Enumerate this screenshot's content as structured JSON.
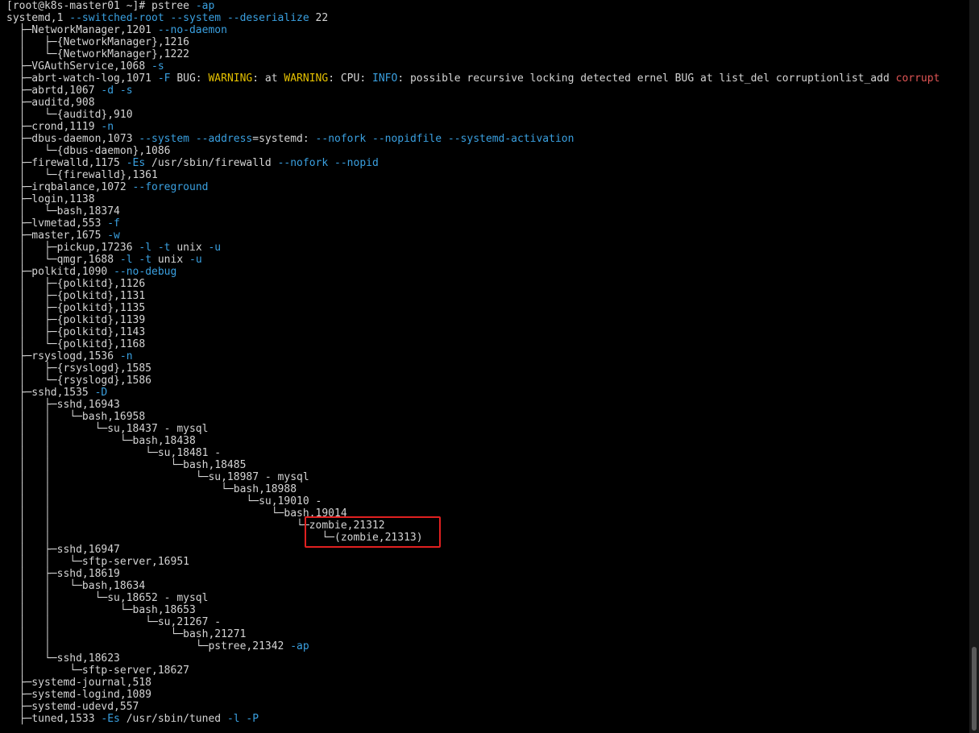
{
  "colors": {
    "background": "#000000",
    "text": "#d4d4d4",
    "arg": "#3aa0e0",
    "warn": "#e5c100",
    "info": "#3aa0e0",
    "err": "#e05555",
    "highlight_border": "#e02020"
  },
  "terminal": {
    "lines": [
      [
        {
          "t": "[root@k8s-master01 ~]# pstree "
        },
        {
          "t": "-ap",
          "c": "arg"
        }
      ],
      [
        {
          "t": "systemd,1 "
        },
        {
          "t": "--switched-root --system --deserialize",
          "c": "arg"
        },
        {
          "t": " 22"
        }
      ],
      [
        {
          "t": "  ├─NetworkManager,1201 "
        },
        {
          "t": "--no-daemon",
          "c": "arg"
        }
      ],
      [
        {
          "t": "  │   ├─{NetworkManager},1216"
        }
      ],
      [
        {
          "t": "  │   └─{NetworkManager},1222"
        }
      ],
      [
        {
          "t": "  ├─VGAuthService,1068 "
        },
        {
          "t": "-s",
          "c": "arg"
        }
      ],
      [
        {
          "t": "  ├─abrt-watch-log,1071 "
        },
        {
          "t": "-F",
          "c": "arg"
        },
        {
          "t": " BUG: "
        },
        {
          "t": "WARNING",
          "c": "warn"
        },
        {
          "t": ": at "
        },
        {
          "t": "WARNING",
          "c": "warn"
        },
        {
          "t": ": CPU: "
        },
        {
          "t": "INFO",
          "c": "info"
        },
        {
          "t": ": possible recursive locking detected ernel BUG at list_del corruptionlist_add "
        },
        {
          "t": "corrupt",
          "c": "err"
        }
      ],
      [
        {
          "t": "  ├─abrtd,1067 "
        },
        {
          "t": "-d -s",
          "c": "arg"
        }
      ],
      [
        {
          "t": "  ├─auditd,908"
        }
      ],
      [
        {
          "t": "  │   └─{auditd},910"
        }
      ],
      [
        {
          "t": "  ├─crond,1119 "
        },
        {
          "t": "-n",
          "c": "arg"
        }
      ],
      [
        {
          "t": "  ├─dbus-daemon,1073 "
        },
        {
          "t": "--system --address",
          "c": "arg"
        },
        {
          "t": "=systemd: "
        },
        {
          "t": "--nofork --nopidfile --systemd-activation",
          "c": "arg"
        }
      ],
      [
        {
          "t": "  │   └─{dbus-daemon},1086"
        }
      ],
      [
        {
          "t": "  ├─firewalld,1175 "
        },
        {
          "t": "-Es",
          "c": "arg"
        },
        {
          "t": " /usr/sbin/firewalld "
        },
        {
          "t": "--nofork --nopid",
          "c": "arg"
        }
      ],
      [
        {
          "t": "  │   └─{firewalld},1361"
        }
      ],
      [
        {
          "t": "  ├─irqbalance,1072 "
        },
        {
          "t": "--foreground",
          "c": "arg"
        }
      ],
      [
        {
          "t": "  ├─login,1138"
        }
      ],
      [
        {
          "t": "  │   └─bash,18374"
        }
      ],
      [
        {
          "t": "  ├─lvmetad,553 "
        },
        {
          "t": "-f",
          "c": "arg"
        }
      ],
      [
        {
          "t": "  ├─master,1675 "
        },
        {
          "t": "-w",
          "c": "arg"
        }
      ],
      [
        {
          "t": "  │   ├─pickup,17236 "
        },
        {
          "t": "-l -t",
          "c": "arg"
        },
        {
          "t": " unix "
        },
        {
          "t": "-u",
          "c": "arg"
        }
      ],
      [
        {
          "t": "  │   └─qmgr,1688 "
        },
        {
          "t": "-l -t",
          "c": "arg"
        },
        {
          "t": " unix "
        },
        {
          "t": "-u",
          "c": "arg"
        }
      ],
      [
        {
          "t": "  ├─polkitd,1090 "
        },
        {
          "t": "--no-debug",
          "c": "arg"
        }
      ],
      [
        {
          "t": "  │   ├─{polkitd},1126"
        }
      ],
      [
        {
          "t": "  │   ├─{polkitd},1131"
        }
      ],
      [
        {
          "t": "  │   ├─{polkitd},1135"
        }
      ],
      [
        {
          "t": "  │   ├─{polkitd},1139"
        }
      ],
      [
        {
          "t": "  │   ├─{polkitd},1143"
        }
      ],
      [
        {
          "t": "  │   └─{polkitd},1168"
        }
      ],
      [
        {
          "t": "  ├─rsyslogd,1536 "
        },
        {
          "t": "-n",
          "c": "arg"
        }
      ],
      [
        {
          "t": "  │   ├─{rsyslogd},1585"
        }
      ],
      [
        {
          "t": "  │   └─{rsyslogd},1586"
        }
      ],
      [
        {
          "t": "  ├─sshd,1535 "
        },
        {
          "t": "-D",
          "c": "arg"
        }
      ],
      [
        {
          "t": "  │   ├─sshd,16943"
        }
      ],
      [
        {
          "t": "  │   │   └─bash,16958"
        }
      ],
      [
        {
          "t": "  │   │       └─su,18437 - mysql"
        }
      ],
      [
        {
          "t": "  │   │           └─bash,18438"
        }
      ],
      [
        {
          "t": "  │   │               └─su,18481 -"
        }
      ],
      [
        {
          "t": "  │   │                   └─bash,18485"
        }
      ],
      [
        {
          "t": "  │   │                       └─su,18987 - mysql"
        }
      ],
      [
        {
          "t": "  │   │                           └─bash,18988"
        }
      ],
      [
        {
          "t": "  │   │                               └─su,19010 -"
        }
      ],
      [
        {
          "t": "  │   │                                   └─bash,19014"
        }
      ],
      [
        {
          "t": "  │   │                                       └─zombie,21312"
        }
      ],
      [
        {
          "t": "  │   │                                           └─(zombie,21313)"
        }
      ],
      [
        {
          "t": "  │   ├─sshd,16947"
        }
      ],
      [
        {
          "t": "  │   │   └─sftp-server,16951"
        }
      ],
      [
        {
          "t": "  │   ├─sshd,18619"
        }
      ],
      [
        {
          "t": "  │   │   └─bash,18634"
        }
      ],
      [
        {
          "t": "  │   │       └─su,18652 - mysql"
        }
      ],
      [
        {
          "t": "  │   │           └─bash,18653"
        }
      ],
      [
        {
          "t": "  │   │               └─su,21267 -"
        }
      ],
      [
        {
          "t": "  │   │                   └─bash,21271"
        }
      ],
      [
        {
          "t": "  │   │                       └─pstree,21342 "
        },
        {
          "t": "-ap",
          "c": "arg"
        }
      ],
      [
        {
          "t": "  │   └─sshd,18623"
        }
      ],
      [
        {
          "t": "  │       └─sftp-server,18627"
        }
      ],
      [
        {
          "t": "  ├─systemd-journal,518"
        }
      ],
      [
        {
          "t": "  ├─systemd-logind,1089"
        }
      ],
      [
        {
          "t": "  ├─systemd-udevd,557"
        }
      ],
      [
        {
          "t": "  ├─tuned,1533 "
        },
        {
          "t": "-Es",
          "c": "arg"
        },
        {
          "t": " /usr/sbin/tuned "
        },
        {
          "t": "-l -P",
          "c": "arg"
        }
      ]
    ]
  }
}
